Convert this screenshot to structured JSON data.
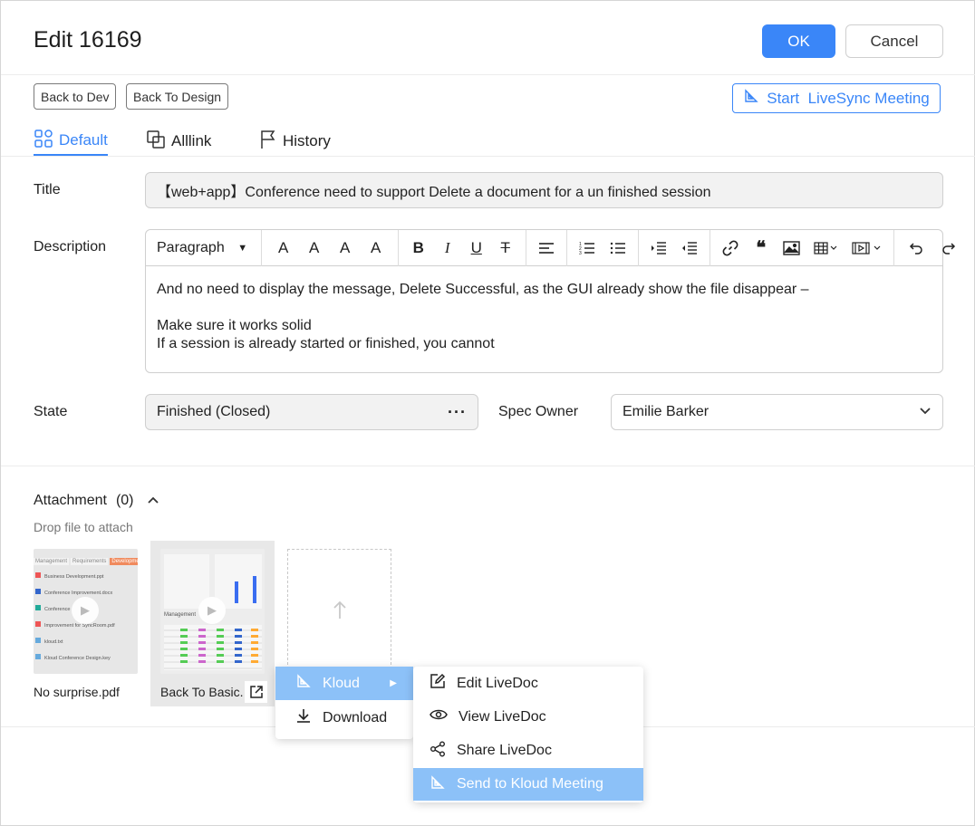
{
  "header": {
    "title": "Edit 16169",
    "ok_label": "OK",
    "cancel_label": "Cancel"
  },
  "actions": {
    "back_to_dev": "Back to Dev",
    "back_to_design": "Back To Design",
    "live_sync": "Start  LiveSync Meeting"
  },
  "tabs": [
    {
      "label": "Default",
      "icon": "apps-icon",
      "active": true
    },
    {
      "label": "Alllink",
      "icon": "copy-link-icon",
      "active": false
    },
    {
      "label": "History",
      "icon": "flag-icon",
      "active": false
    }
  ],
  "form": {
    "title_label": "Title",
    "title_value": "【web+app】Conference need to support Delete a document for a un finished session",
    "description_label": "Description",
    "paragraph_label": "Paragraph",
    "description_lines": [
      "And no need to display the message, Delete Successful, as the GUI already show the file disappear –",
      "",
      "Make sure it works solid",
      "If a session is already started or finished, you cannot"
    ],
    "state_label": "State",
    "state_value": "Finished (Closed)",
    "spec_owner_label": "Spec Owner",
    "spec_owner_value": "Emilie Barker"
  },
  "attachment": {
    "title": "Attachment",
    "count": "(0)",
    "drop_hint": "Drop file to attach",
    "files": [
      {
        "name": "No surprise.pdf"
      },
      {
        "name": "Back To Basic."
      }
    ],
    "thumb1": {
      "tabs": [
        "Management",
        "Requirements",
        "Development",
        "De"
      ],
      "items": [
        "Business Development.ppt",
        "Conference Improvement.docx",
        "Conference",
        "Improvement for SyncRoom.pdf",
        "kloud.txt",
        "Kloud Conference Design.key"
      ]
    },
    "thumb2": {
      "heading": "Management"
    }
  },
  "menu": {
    "items": [
      {
        "label": "Kloud",
        "icon": "kloud-icon",
        "highlighted": true
      },
      {
        "label": "Download",
        "icon": "download-icon",
        "highlighted": false
      }
    ],
    "submenu": [
      {
        "label": "Edit LiveDoc",
        "icon": "edit-icon",
        "highlighted": false
      },
      {
        "label": "View LiveDoc",
        "icon": "eye-icon",
        "highlighted": false
      },
      {
        "label": "Share LiveDoc",
        "icon": "share-icon",
        "highlighted": false
      },
      {
        "label": "Send to Kloud Meeting",
        "icon": "kloud-icon",
        "highlighted": true
      }
    ]
  },
  "colors": {
    "accent": "#3a86f8",
    "menu_highlight": "#8cc1f8"
  }
}
